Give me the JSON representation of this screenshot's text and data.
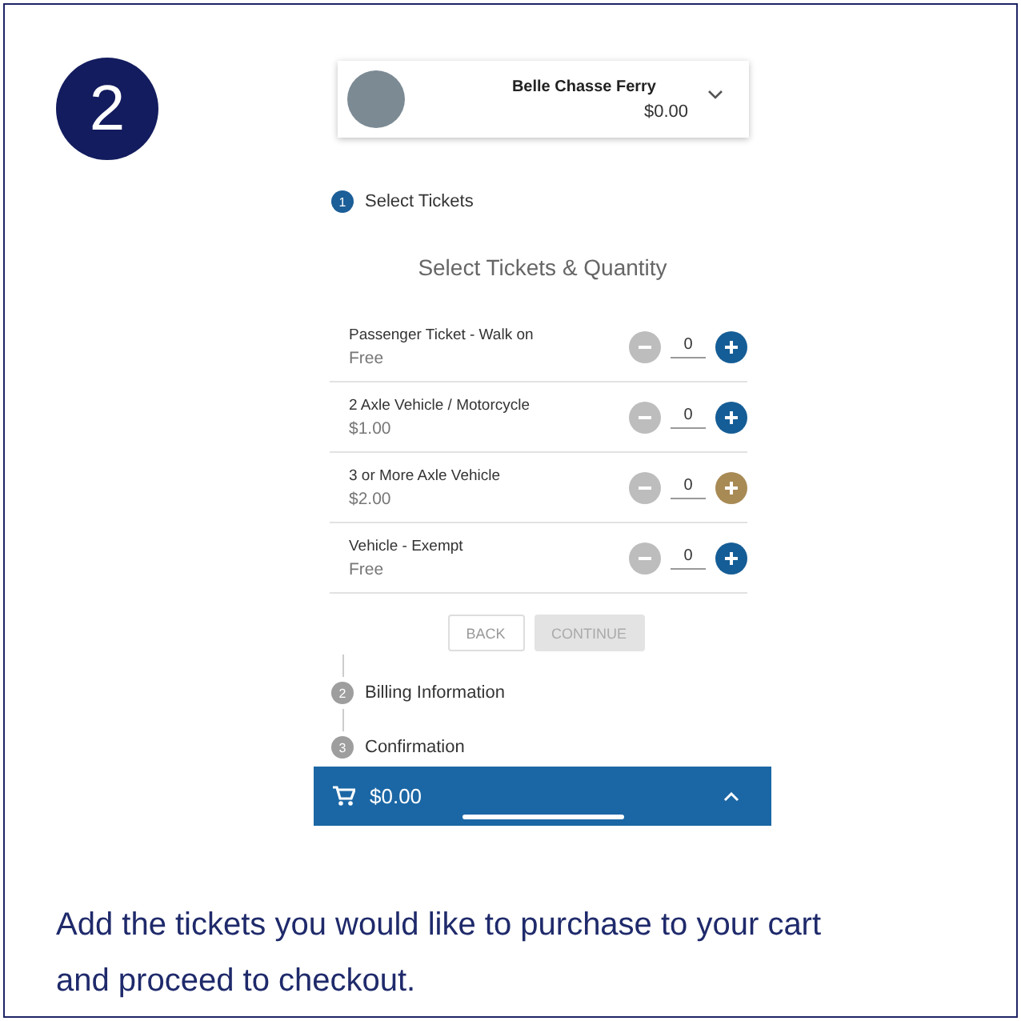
{
  "step_badge": "2",
  "app": {
    "ferry": {
      "name": "Belle Chasse Ferry",
      "total": "$0.00"
    },
    "steps": [
      {
        "number": "1",
        "label": "Select Tickets",
        "active": true
      },
      {
        "number": "2",
        "label": "Billing Information",
        "active": false
      },
      {
        "number": "3",
        "label": "Confirmation",
        "active": false
      }
    ],
    "heading": "Select Tickets & Quantity",
    "tickets": [
      {
        "name": "Passenger Ticket - Walk on",
        "price": "Free",
        "quantity": "0",
        "pressed": false
      },
      {
        "name": "2 Axle Vehicle / Motorcycle",
        "price": "$1.00",
        "quantity": "0",
        "pressed": false
      },
      {
        "name": "3 or More Axle Vehicle",
        "price": "$2.00",
        "quantity": "0",
        "pressed": true
      },
      {
        "name": "Vehicle - Exempt",
        "price": "Free",
        "quantity": "0",
        "pressed": false
      }
    ],
    "buttons": [
      {
        "label": "BACK",
        "disabled": false
      },
      {
        "label": "CONTINUE",
        "disabled": true
      }
    ],
    "cart": {
      "total": "$0.00"
    }
  },
  "caption": "Add the tickets you would like to purchase to your cart and proceed to checkout."
}
